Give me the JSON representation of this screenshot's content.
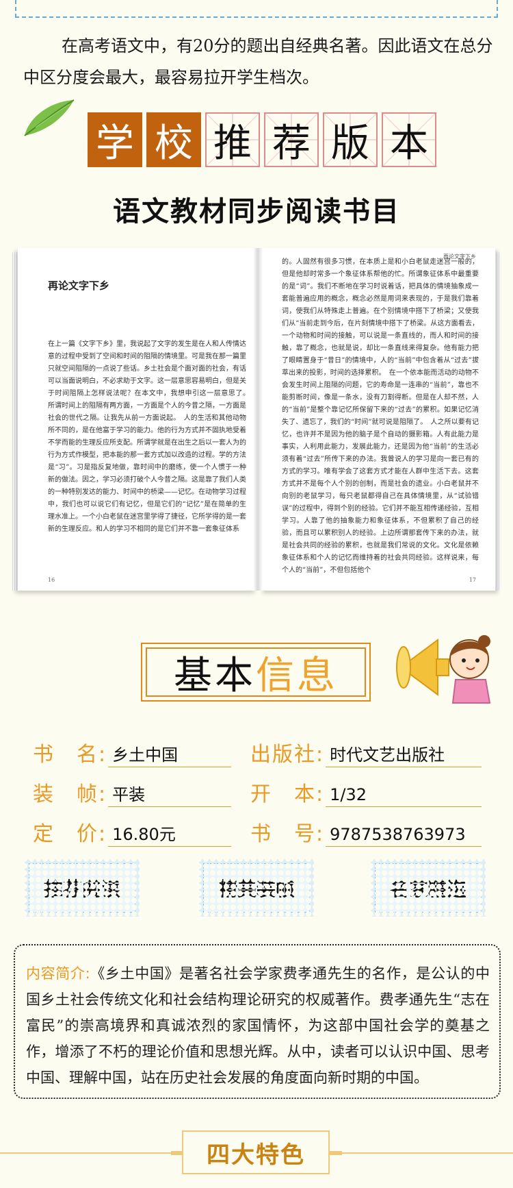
{
  "intro": {
    "text": "在高考语文中，有20分的题出自经典名著。因此语文在总分中区分度会最大，最容易拉开学生档次。"
  },
  "title": {
    "chars": [
      "学",
      "校",
      "推",
      "荐",
      "版",
      "本"
    ],
    "subtitle": "语文教材同步阅读书目"
  },
  "book_preview": {
    "chapter_title": "再论文字下乡",
    "running_header": "再论文字下乡",
    "left_page_number": "16",
    "right_page_number": "17",
    "left_text": "在上一篇《文字下乡》里，我说起了文字的发生是在人和人传情达意的过程中受到了空间和时间的阻隔的情境里。可是我在那一篇里只就空间阻隔的一点说了些话。乡土社会是个面对面的社会，有话可以当面说明白，不必求助于文字。这一层意思容易明白，但是关于时间阻隔上怎样说法呢？在本文中，我想申引这一层意思了。　所谓时间上的阻隔有两方面，一方面是个人的今昔之隔，一方面是社会的世代之隔。让我先从前一方面说起。　人的生活和其他动物所不同的，是在他富于学习的能力。他的行为方式并不固执地受着不学而能的生理反应所支配。所谓学就是在出生之后以一套人为的行为方式作模型，把本能的那一套方式加以改造的过程。学的方法是“习”。习是指反复地做，靠时间中的磨练，使一个人惯于一种新的做法。因之，学习必须打破个人今昔之隔。这是靠了我们人类的一种特别发达的能力、时间中的桥梁——记忆。在动物学习过程中，我们也可以说它们有记忆，但是它们的“记忆”是在简单的生理水准上。一个小白老鼠在迷宫里学得了捷径，它所学得的是一套新的生理反应。和人的学习不相同的是它们并不靠一套象征体系",
    "right_text": "的。人固然有很多习惯，在本质上是和小白老鼠走迷宫一般的，但是他却时常多一个象征体系帮他的忙。所谓象征体系中最重要的是“词”。我们不断地在学习时说着话，把具体的情境抽象成一套能普遍应用的概念，概念必然是用词来表现的，于是我们靠着词，使我们从特殊走上普遍。在个别情境中搭下了桥梁；又使我们从“当前走到今后，在片刻情境中搭下了桥梁。从这方面看去，一个动物和时间的接触，可以说是一条直线的，而人和时间的接触，靠了概念，也就是说，却比一条直线来得复杂。他有能力把了眼睛置身于“昔日”的情境中，人的“当前”中包含着从“过去”拔萃出来的投影，时间的选择累积。　在一个依本能而活动的动物不会发生时间上阻隔的问题，它的寿命是一连串的“当前”，靠也不能剪断时间，像是一条水，没有刀割得断。但是在人却不然，人的“当前”是整个靠记忆所保留下来的“过去”的累积。如果记忆消失了、遗忘了，我们的“时间”就可说是阻隔了。　人之所以要有记忆，也许并不是因为他的脑子是个自动的摄影箱。人有此能力是事实，人利用此能力，发展此能力，还是因为他“当前”的生活必须有着“过去”所传下来的办法。我曾说人的学习是向一套已有的方式的学习。唯有学会了这套方式才能在人群中生活下去。这套方式并不是每个人个别的创制，而是社会的遗业。小白老鼠并不向别的老鼠学习，每只老鼠都得自己在具体情境里，从“试验错误”的过程中，得到个别的经验。它们并不能互相传递经验，互相学习。人靠了他的抽象能力和象征体系，不但累积了自己的经验，而且可以累积别人的经验。上边所谓那套传下来的办法，就是社会共同的经验的累积，也就是我们常说的文化。文化是依赖象征体系和个人的记忆而维持着的社会共同经验。这样说来，每个人的“当前”，不但包括他个"
  },
  "info": {
    "heading_black": "基本",
    "heading_orange": "信息",
    "fields": [
      {
        "label": "书　名:",
        "value": "乡土中国"
      },
      {
        "label": "出版社:",
        "value": "时代文艺出版社"
      },
      {
        "label": "装　帧:",
        "value": "平装"
      },
      {
        "label": "开　本:",
        "value": "1/32"
      },
      {
        "label": "定　价:",
        "value": "16.80元"
      },
      {
        "label": "书　号:",
        "value": "9787538763973"
      }
    ]
  },
  "badges": [
    "推荐阅读",
    "精美装帧",
    "名家精选"
  ],
  "description": {
    "label": "内容简介:",
    "text": "《乡土中国》是著名社会学家费孝通先生的名作，是公认的中国乡土社会传统文化和社会结构理论研究的权威著作。费孝通先生“志在富民”的崇高境界和真诚浓烈的家国情怀，为这部中国社会学的奠基之作，增添了不朽的理论价值和思想光辉。从中，读者可以认识中国、思考中国、理解中国，站在历史社会发展的角度面向新时期的中国。"
  },
  "section_title": "四大特色",
  "colors": {
    "accent_orange": "#e89a27",
    "title_brown": "#c0620e",
    "badge_blue": "#dceef8",
    "background": "#fdfcf1"
  },
  "icons": [
    "leaf-icon",
    "megaphone-girl-illustration"
  ]
}
